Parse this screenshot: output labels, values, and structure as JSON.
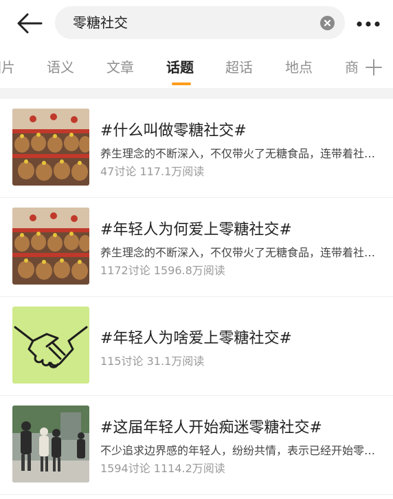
{
  "search": {
    "query": "零糖社交"
  },
  "tabs": [
    {
      "label": "图片",
      "active": false
    },
    {
      "label": "语义",
      "active": false
    },
    {
      "label": "文章",
      "active": false
    },
    {
      "label": "话题",
      "active": true
    },
    {
      "label": "超话",
      "active": false
    },
    {
      "label": "地点",
      "active": false
    },
    {
      "label": "商品",
      "active": false
    }
  ],
  "results": [
    {
      "title": "#什么叫做零糖社交#",
      "desc": "养生理念的不断深入，不仅带火了无糖食品，连带着社交方式也开始无糖",
      "stats": "47讨论 117.1万阅读",
      "thumb": "capybara-plush-display"
    },
    {
      "title": "#年轻人为何爱上零糖社交#",
      "desc": "养生理念的不断深入，不仅带火了无糖食品，连带着社交方式也开始无糖",
      "stats": "1172讨论 1596.8万阅读",
      "thumb": "capybara-plush-display"
    },
    {
      "title": "#年轻人为啥爱上零糖社交#",
      "desc": "",
      "stats": "115讨论 31.1万阅读",
      "thumb": "handshake-illustration"
    },
    {
      "title": "#这届年轻人开始痴迷零糖社交#",
      "desc": "不少追求边界感的年轻人，纷纷共情，表示已经开始零糖社交",
      "stats": "1594讨论 1114.2万阅读",
      "thumb": "group-photo"
    }
  ],
  "colors": {
    "accent": "#ff9d1b",
    "handshake_bg": "#cfea8b"
  }
}
